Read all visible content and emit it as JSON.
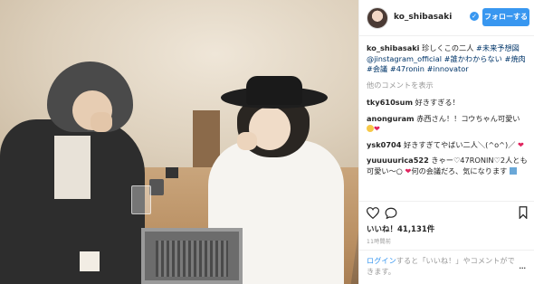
{
  "post": {
    "username": "ko_shibasaki",
    "follow_label": "フォローする",
    "verified_badge": "✓"
  },
  "caption": {
    "username": "ko_shibasaki",
    "text": " 珍しくこの二人",
    "tags": [
      "#未来予想図",
      "@jinstagram_official",
      "#誰かわからない",
      "#焼肉",
      "#会議",
      "#47ronin",
      "#innovator"
    ]
  },
  "more_comments_label": "他のコメントを表示",
  "comments": [
    {
      "username": "tky610sum",
      "text": " 好きすぎる！"
    },
    {
      "username": "anonguram",
      "text": " 赤西さん！！コウちゃん可愛い",
      "emoji": [
        "face",
        "heart"
      ]
    },
    {
      "username": "ysk0704",
      "text": " 好きすぎてやばい二人＼(^o^)／",
      "emoji": [
        "heart"
      ]
    },
    {
      "username": "yuuuuurica522",
      "text": " きゃー♡47RONIN♡2人とも可愛い〜○",
      "text2": "何の会議だろ、気になります",
      "emoji": [
        "heart",
        "image"
      ]
    }
  ],
  "likes_label": "いいね！41,131件",
  "time_ago": "11時間前",
  "footer": {
    "prefix": "ログイン",
    "middle": "すると「いいね！」やコメントができます。",
    "more_icon": "..."
  },
  "colors": {
    "accent": "#3897f0",
    "tag": "#003569",
    "muted": "#999999"
  },
  "icons": [
    "heart-icon",
    "comment-icon",
    "bookmark-icon",
    "more-options-icon",
    "verified-icon"
  ]
}
